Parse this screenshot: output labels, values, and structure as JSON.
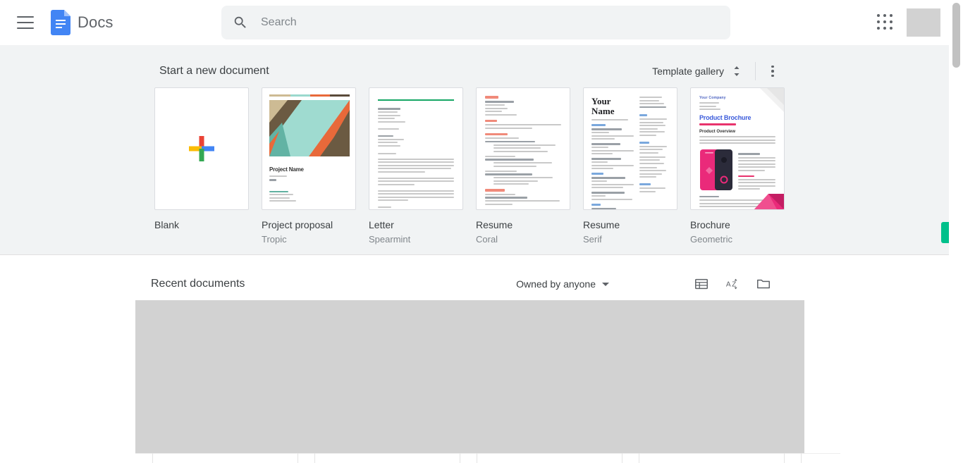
{
  "header": {
    "menu_icon": "hamburger-menu-icon",
    "product_icon": "google-docs-icon",
    "product_name": "Docs",
    "search": {
      "icon": "search-icon",
      "placeholder": "Search",
      "value": ""
    },
    "apps_icon": "google-apps-grid-icon",
    "avatar": "account-avatar"
  },
  "templates": {
    "section_title": "Start a new document",
    "gallery_label": "Template gallery",
    "gallery_toggle_icon": "chevron-up-down-icon",
    "more_icon": "more-vertical-icon",
    "items": [
      {
        "name": "Blank",
        "subtitle": "",
        "thumb": "blank-plus-icon"
      },
      {
        "name": "Project proposal",
        "subtitle": "Tropic",
        "thumb": "tropic-geometric-cover"
      },
      {
        "name": "Letter",
        "subtitle": "Spearmint",
        "thumb": "spearmint-letter"
      },
      {
        "name": "Resume",
        "subtitle": "Coral",
        "thumb": "coral-resume"
      },
      {
        "name": "Resume",
        "subtitle": "Serif",
        "thumb": "serif-resume"
      },
      {
        "name": "Brochure",
        "subtitle": "Geometric",
        "thumb": "geometric-brochure"
      }
    ],
    "thumb_text": {
      "project_name": "Project Name",
      "serif_name": "Your Name",
      "brochure_company": "Your Company",
      "brochure_title": "Product Brochure",
      "brochure_section": "Product Overview"
    }
  },
  "recent": {
    "section_title": "Recent documents",
    "owner_filter": "Owned by anyone",
    "owner_caret_icon": "caret-down-icon",
    "list_view_icon": "list-view-icon",
    "sort_icon": "sort-az-icon",
    "folder_icon": "folder-icon",
    "placeholder_state": "loading"
  },
  "chrome": {
    "scrollbar": "vertical-scrollbar",
    "side_tab": "green-side-tab"
  },
  "colors": {
    "docs_blue": "#4285f4",
    "page_bg": "#ffffff",
    "strip_bg": "#f1f3f4",
    "search_bg": "#f1f3f4",
    "text_primary": "#3c4043",
    "text_secondary": "#80868b",
    "placeholder_gray": "#d2d2d2",
    "green_tab": "#00c08b",
    "google_red": "#ea4335",
    "google_yellow": "#fbbc04",
    "google_green": "#34a853"
  }
}
